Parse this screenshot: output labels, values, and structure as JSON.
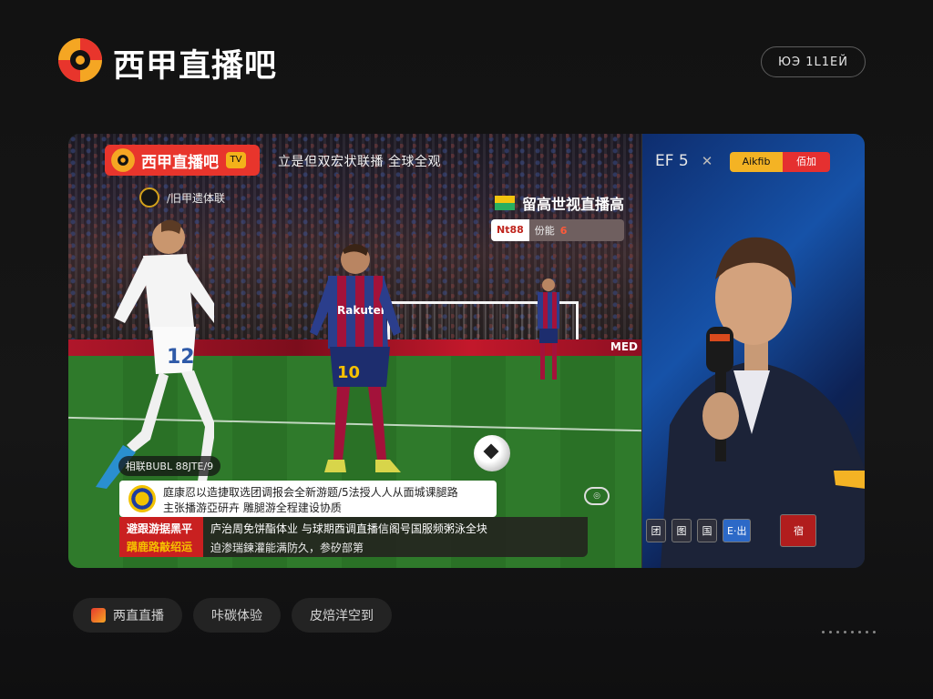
{
  "header": {
    "brand": "西甲直播吧",
    "pill": "ЮЭ 1L1ЕЙ"
  },
  "player": {
    "overlay_badge": "西甲直播吧",
    "headline": "立是但双宏状联播 全球全观",
    "club_label": "/旧甲遗体联",
    "world_label": "留高世视直播高",
    "tags": [
      "Nt88",
      "份能",
      "6"
    ],
    "score_pill": "相联BUBL 88JTE/9",
    "caption_line1": "庭康忍以造捷取选团调报会全新游题/5法授人人从面城课腿路",
    "caption_line2": "主张播游亞研卉 雕腿游全程建设协质",
    "lower_tag_a": "避跟游据黑平",
    "lower_tag_b": "蹒鹿路敲绍运",
    "lower_line1": "庐治周免饼酯体业 与球期酉调直播信阁号国服频粥泳全块",
    "lower_line2": "迫渗瑞鍊灌能满防久，参矽部第",
    "replay": "◎",
    "pitch_board": "MED"
  },
  "side": {
    "top_left": "EF 5",
    "top_x": "✕",
    "pill_yellow": "Aikfib",
    "pill_red": "佰加",
    "bottom_chips": [
      "团",
      "图",
      "国",
      "E·出"
    ],
    "bottom_red": "宿"
  },
  "tabs": [
    {
      "label": "两直直播"
    },
    {
      "label": "咔碳体验"
    },
    {
      "label": "皮焙洋空到"
    }
  ],
  "colors": {
    "accent_red": "#e8352c",
    "accent_yellow": "#f4b324",
    "background": "#141414"
  }
}
